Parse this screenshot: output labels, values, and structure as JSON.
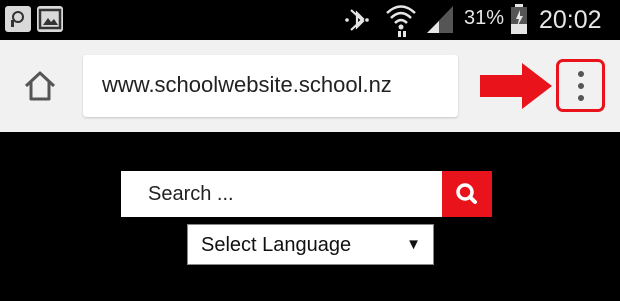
{
  "status_bar": {
    "battery_percent": "31%",
    "time": "20:02",
    "icons": [
      "messaging-icon",
      "gallery-icon",
      "bluetooth-icon",
      "wifi-icon",
      "signal-icon",
      "battery-icon"
    ]
  },
  "browser": {
    "url": "www.schoolwebsite.school.nz",
    "home_icon": "home-icon",
    "menu_icon": "overflow-menu-icon",
    "annotation_arrow_color": "#e8131b",
    "annotation_box_color": "#e8131b"
  },
  "page": {
    "search_placeholder": "Search ...",
    "search_button_color": "#e8131b",
    "search_icon": "magnifier-icon",
    "language_select_value": "Select Language",
    "language_caret": "▼"
  }
}
